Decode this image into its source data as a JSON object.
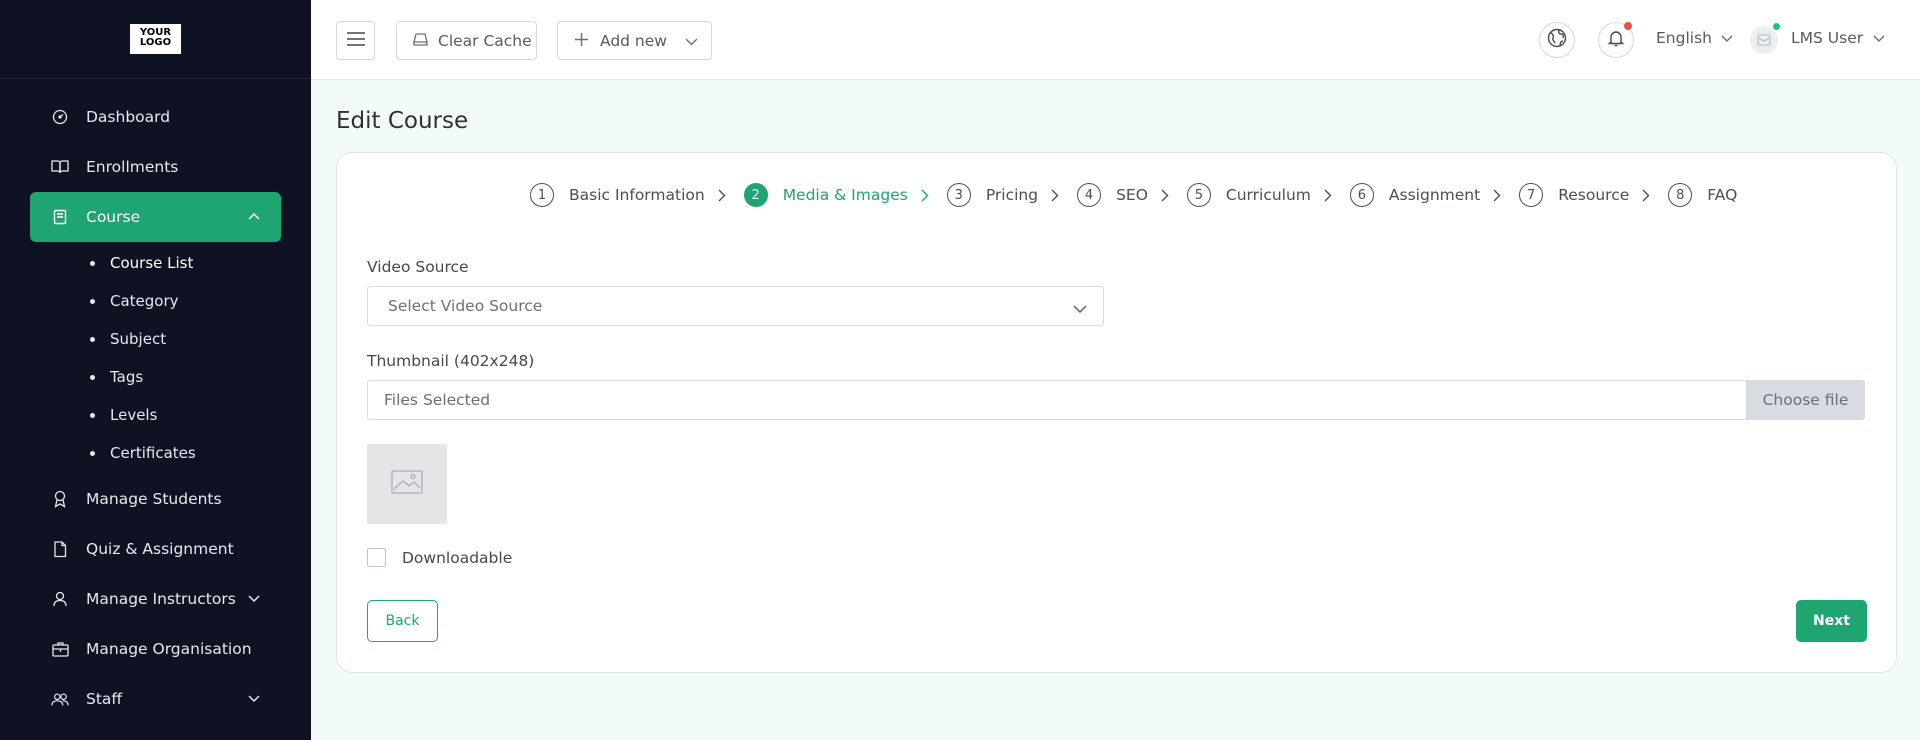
{
  "sidebar": {
    "logo_lines": [
      "YOUR",
      "LOGO"
    ],
    "items": [
      {
        "label": "Dashboard",
        "icon": "speedometer-icon"
      },
      {
        "label": "Enrollments",
        "icon": "book-open-icon"
      },
      {
        "label": "Course",
        "icon": "book-icon",
        "active": true,
        "expanded": true
      },
      {
        "label": "Manage Students",
        "icon": "award-icon"
      },
      {
        "label": "Quiz & Assignment",
        "icon": "file-icon"
      },
      {
        "label": "Manage Instructors",
        "icon": "user-icon",
        "has_children": true
      },
      {
        "label": "Manage Organisation",
        "icon": "building-icon"
      },
      {
        "label": "Staff",
        "icon": "users-icon",
        "has_children": true
      }
    ],
    "course_sub_items": [
      "Course List",
      "Category",
      "Subject",
      "Tags",
      "Levels",
      "Certificates"
    ],
    "current_sub_item": "Course List"
  },
  "topbar": {
    "clear_cache_label": "Clear Cache",
    "add_new_label": "Add new",
    "language": "English",
    "user_name": "LMS User"
  },
  "page": {
    "title": "Edit Course"
  },
  "stepper": {
    "steps": [
      {
        "num": "1",
        "label": "Basic Information"
      },
      {
        "num": "2",
        "label": "Media & Images",
        "active": true
      },
      {
        "num": "3",
        "label": "Pricing"
      },
      {
        "num": "4",
        "label": "SEO"
      },
      {
        "num": "5",
        "label": "Curriculum"
      },
      {
        "num": "6",
        "label": "Assignment"
      },
      {
        "num": "7",
        "label": "Resource"
      },
      {
        "num": "8",
        "label": "FAQ"
      }
    ]
  },
  "form": {
    "video_source_label": "Video Source",
    "video_source_placeholder": "Select Video Source",
    "thumbnail_label": "Thumbnail (402x248)",
    "file_placeholder": "Files Selected",
    "choose_file_label": "Choose file",
    "downloadable_label": "Downloadable",
    "back_label": "Back",
    "next_label": "Next"
  },
  "colors": {
    "accent": "#1fa572",
    "sidebar_bg": "#0f1222",
    "page_bg": "#f3fbf8"
  }
}
